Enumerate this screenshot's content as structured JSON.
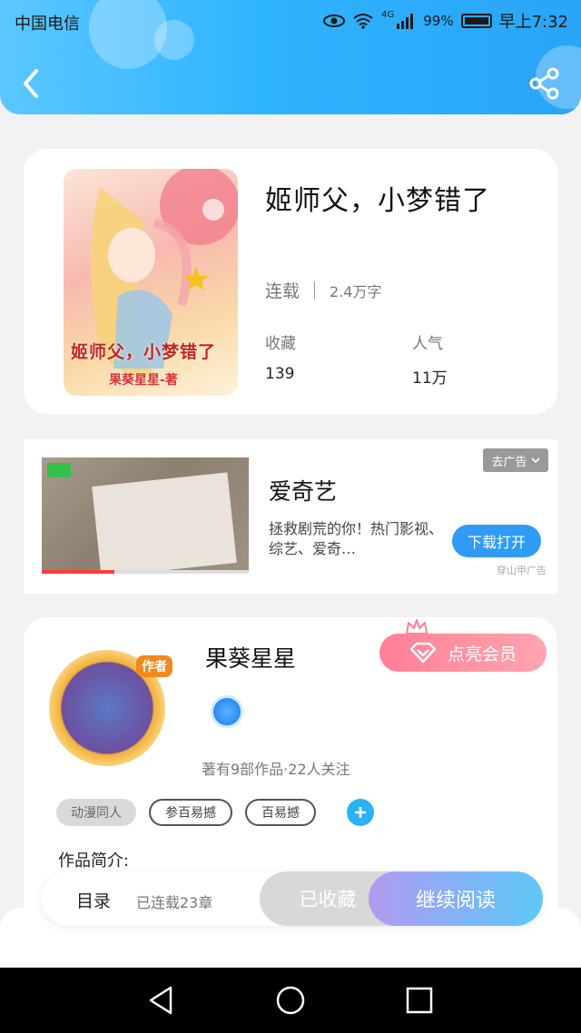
{
  "status_bar": {
    "carrier": "中国电信",
    "network": "4G",
    "battery": "99%",
    "time": "早上7:32"
  },
  "header": {
    "back_icon": "chevron-left-icon",
    "share_icon": "share-icon"
  },
  "book": {
    "cover_title": "姬师父，小梦错了",
    "cover_author": "果葵星星-著",
    "title": "姬师父，小梦错了",
    "status": "连载",
    "word_count": "2.4万字",
    "collect_label": "收藏",
    "collect_value": "139",
    "popularity_label": "人气",
    "popularity_value": "11万"
  },
  "ad": {
    "title": "爱奇艺",
    "description": "拯救剧荒的你！热门影视、综艺、爱奇…",
    "tag": "去广告",
    "button": "下载打开",
    "source": "穿山甲广告",
    "video_progress": 0.35
  },
  "author": {
    "name": "果葵星星",
    "avatar_badge": "作者",
    "vip_button": "点亮会员",
    "stats": "著有9部作品·22人关注",
    "tags": [
      "动漫同人",
      "参百易撼",
      "百易撼"
    ],
    "intro_label": "作品简介:"
  },
  "action_bar": {
    "toc_label": "目录",
    "toc_progress": "已连载23章",
    "collected_button": "已收藏",
    "read_button": "继续阅读"
  },
  "colors": {
    "header_blue": "#2fb4ff",
    "accent_blue": "#2f9bf5",
    "vip_pink": "#ff7f95"
  }
}
